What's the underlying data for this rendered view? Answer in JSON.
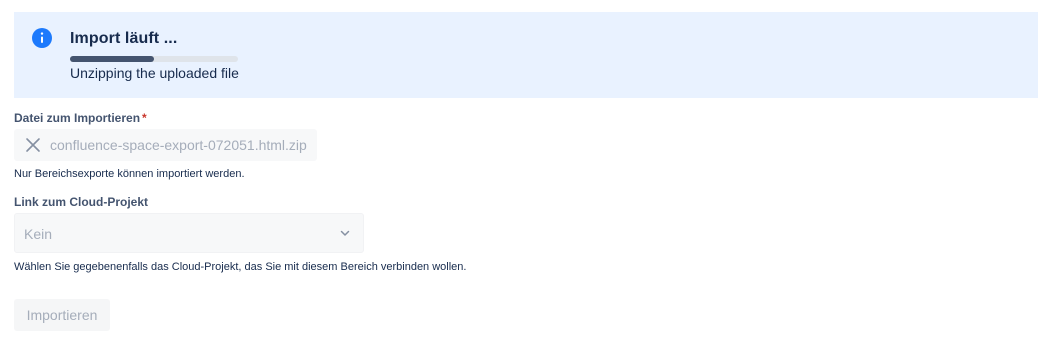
{
  "banner": {
    "title": "Import läuft ...",
    "status": "Unzipping the uploaded file",
    "progress_fraction": 0.5,
    "icon": "info-icon",
    "accent_color": "#1d7afc",
    "background_color": "#e9f2ff"
  },
  "file_field": {
    "label": "Datei zum Importieren",
    "required_mark": "*",
    "value": "confluence-space-export-072051.html.zip",
    "icon": "close-icon",
    "helper": "Nur Bereichsexporte können importiert werden."
  },
  "project_field": {
    "label": "Link zum Cloud-Projekt",
    "value": "Kein",
    "icon": "chevron-down-icon",
    "helper": "Wählen Sie gegebenenfalls das Cloud-Projekt, das Sie mit diesem Bereich verbinden wollen."
  },
  "actions": {
    "import_label": "Importieren"
  }
}
